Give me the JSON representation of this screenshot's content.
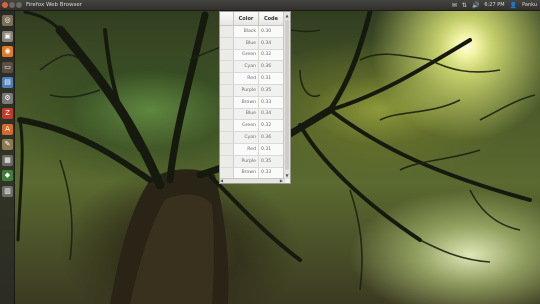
{
  "top_panel": {
    "title": "Firefox Web Browser",
    "clock": "6:27 PM",
    "user": "Panku",
    "indicators": [
      {
        "icon": "mail-icon",
        "glyph": "✉"
      },
      {
        "icon": "network-icon",
        "glyph": "⇅"
      },
      {
        "icon": "volume-icon",
        "glyph": "🔊"
      }
    ]
  },
  "launcher": {
    "items": [
      {
        "name": "dash-home-icon",
        "glyph": "◎",
        "color": "#7b6f5a"
      },
      {
        "name": "files-icon",
        "glyph": "▣",
        "color": "#8a857c"
      },
      {
        "name": "firefox-icon",
        "glyph": "◉",
        "color": "#e07a28"
      },
      {
        "name": "terminal-icon",
        "glyph": "▭",
        "color": "#5a4f46"
      },
      {
        "name": "libreoffice-icon",
        "glyph": "▤",
        "color": "#4f7fb8"
      },
      {
        "name": "settings-icon",
        "glyph": "⚙",
        "color": "#7a7a78"
      },
      {
        "name": "filezilla-icon",
        "glyph": "Z",
        "color": "#c23a2a"
      },
      {
        "name": "ubuntu-software-icon",
        "glyph": "A",
        "color": "#d36a2e"
      },
      {
        "name": "gimp-icon",
        "glyph": "✎",
        "color": "#8c7a52"
      },
      {
        "name": "workspace-icon",
        "glyph": "▦",
        "color": "#6a6a66"
      },
      {
        "name": "app-icon",
        "glyph": "◆",
        "color": "#3f7f3a"
      },
      {
        "name": "trash-icon",
        "glyph": "▥",
        "color": "#6d6d6a"
      }
    ]
  },
  "table": {
    "headers": [
      "Color",
      "Code"
    ],
    "rows": [
      [
        "Black",
        "0.30"
      ],
      [
        "Blue",
        "0.34"
      ],
      [
        "Green",
        "0.32"
      ],
      [
        "Cyan",
        "0.36"
      ],
      [
        "Red",
        "0.31"
      ],
      [
        "Purple",
        "0.35"
      ],
      [
        "Brown",
        "0.33"
      ],
      [
        "Blue",
        "0.34"
      ],
      [
        "Green",
        "0.32"
      ],
      [
        "Cyan",
        "0.36"
      ],
      [
        "Red",
        "0.31"
      ],
      [
        "Purple",
        "0.35"
      ],
      [
        "Brown",
        "0.33"
      ]
    ]
  }
}
